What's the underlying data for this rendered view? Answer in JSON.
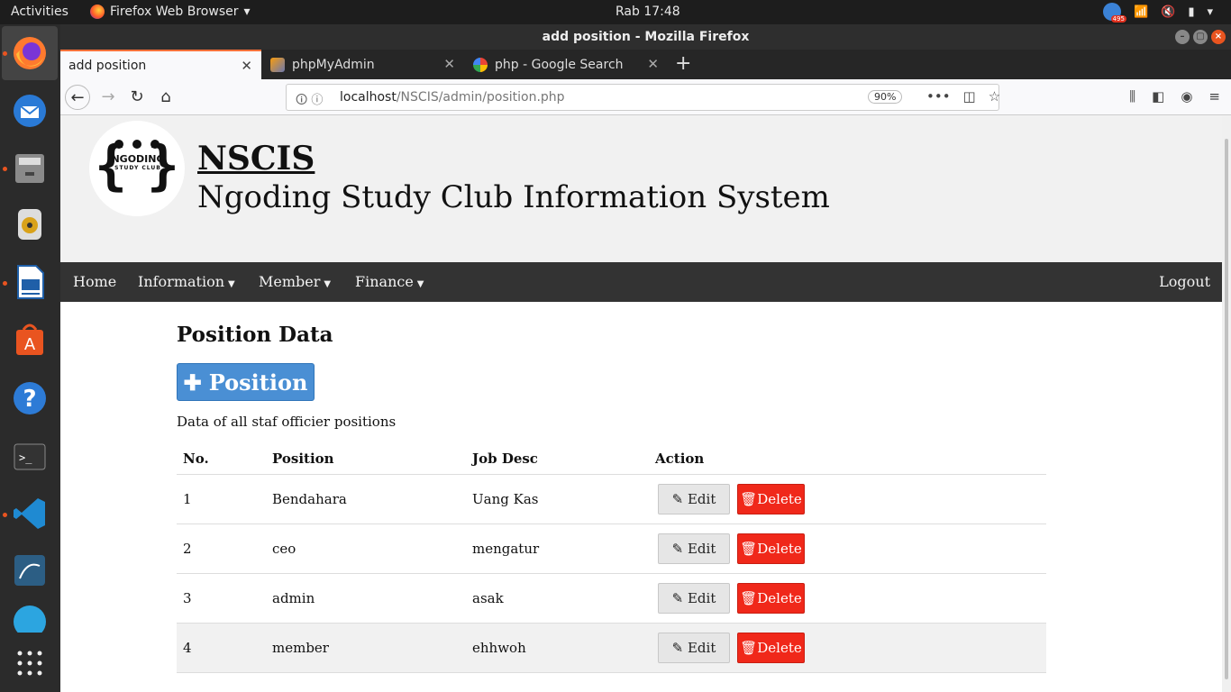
{
  "topbar": {
    "activities": "Activities",
    "app_menu": "Firefox Web Browser",
    "clock": "Rab 17:48",
    "notification_count": "495"
  },
  "window": {
    "title": "add position - Mozilla Firefox"
  },
  "tabs": [
    {
      "label": "add position",
      "active": true
    },
    {
      "label": "phpMyAdmin",
      "active": false
    },
    {
      "label": "php - Google Search",
      "active": false
    }
  ],
  "url": {
    "host": "localhost",
    "path": "/NSCIS/admin/position.php",
    "zoom": "90%"
  },
  "site": {
    "title": "NSCIS",
    "subtitle": "Ngoding Study Club Information System",
    "logo_text": "NGODING",
    "logo_small": "STUDY CLUB"
  },
  "nav": {
    "home": "Home",
    "information": "Information",
    "member": "Member",
    "finance": "Finance",
    "logout": "Logout"
  },
  "main": {
    "heading": "Position Data",
    "add_button": "Position",
    "description": "Data of all staf officier positions",
    "columns": [
      "No.",
      "Position",
      "Job Desc",
      "Action"
    ],
    "rows": [
      {
        "no": "1",
        "position": "Bendahara",
        "job": "Uang Kas"
      },
      {
        "no": "2",
        "position": "ceo",
        "job": "mengatur"
      },
      {
        "no": "3",
        "position": "admin",
        "job": "asak"
      },
      {
        "no": "4",
        "position": "member",
        "job": "ehhwoh"
      }
    ],
    "edit_label": "Edit",
    "delete_label": "Delete"
  }
}
